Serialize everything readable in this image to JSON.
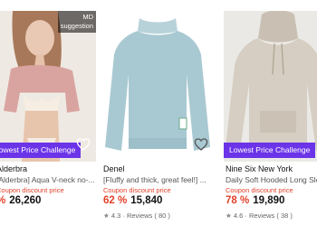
{
  "products": [
    {
      "brand": "Alderbra",
      "title": "[Alderbra] Aqua V-neck no-...",
      "badge": "Lowest Price Challenge",
      "coupon": "Coupon discount price",
      "discount": "%",
      "price": "26,260",
      "md_tag": "MD",
      "md_sub": "suggestion"
    },
    {
      "brand": "Denel",
      "title": "[Fluffy and thick, great feel!] ...",
      "coupon": "Coupon discount price",
      "discount": "62 %",
      "price": "15,840",
      "rating": "4.3",
      "reviews": "Reviews ( 80 )"
    },
    {
      "brand": "Nine Six New York",
      "title": "Daily Soft Hooded Long Sleeve",
      "badge": "Lowest Price Challenge",
      "coupon": "Coupon discount price",
      "discount": "78 %",
      "price": "19,890",
      "rating": "4.6",
      "reviews": "Reviews ( 38 )"
    }
  ],
  "colors": {
    "accent": "#6b34e8",
    "discount": "#e2412a"
  }
}
